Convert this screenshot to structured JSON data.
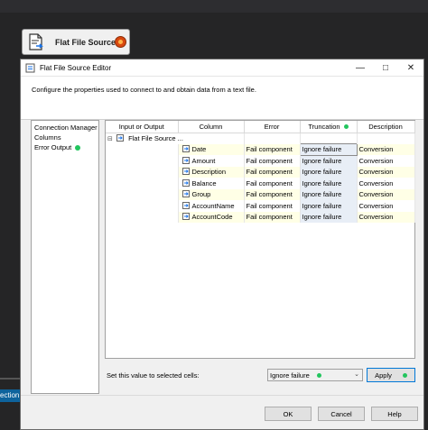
{
  "component": {
    "title": "Flat File Source"
  },
  "side_fragment": "ection",
  "dialog": {
    "title": "Flat File Source Editor",
    "description": "Configure the properties used to connect to and obtain data from a text file.",
    "nav": {
      "items": [
        {
          "label": "Connection Manager",
          "has_indicator": false
        },
        {
          "label": "Columns",
          "has_indicator": false
        },
        {
          "label": "Error Output",
          "has_indicator": true
        }
      ]
    },
    "grid": {
      "headers": [
        "Input or Output",
        "Column",
        "Error",
        "Truncation",
        "Description"
      ],
      "source_row": {
        "label": "Flat File Source ...",
        "expander": "⊟"
      },
      "rows": [
        {
          "column": "Date",
          "error": "Fail component",
          "truncation": "Ignore failure",
          "description": "Conversion"
        },
        {
          "column": "Amount",
          "error": "Fail component",
          "truncation": "Ignore failure",
          "description": "Conversion"
        },
        {
          "column": "Description",
          "error": "Fail component",
          "truncation": "Ignore failure",
          "description": "Conversion"
        },
        {
          "column": "Balance",
          "error": "Fail component",
          "truncation": "Ignore failure",
          "description": "Conversion"
        },
        {
          "column": "Group",
          "error": "Fail component",
          "truncation": "Ignore failure",
          "description": "Conversion"
        },
        {
          "column": "AccountName",
          "error": "Fail component",
          "truncation": "Ignore failure",
          "description": "Conversion"
        },
        {
          "column": "AccountCode",
          "error": "Fail component",
          "truncation": "Ignore failure",
          "description": "Conversion"
        }
      ]
    },
    "set_value": {
      "label": "Set this value to selected cells:",
      "selected": "Ignore failure",
      "apply_label": "Apply"
    },
    "buttons": {
      "ok": "OK",
      "cancel": "Cancel",
      "help": "Help"
    }
  },
  "colors": {
    "indicator_green": "#22c55e",
    "odd_row": "#ffffe6",
    "status_orange": "#d9480f",
    "accent_blue": "#0078d7"
  }
}
